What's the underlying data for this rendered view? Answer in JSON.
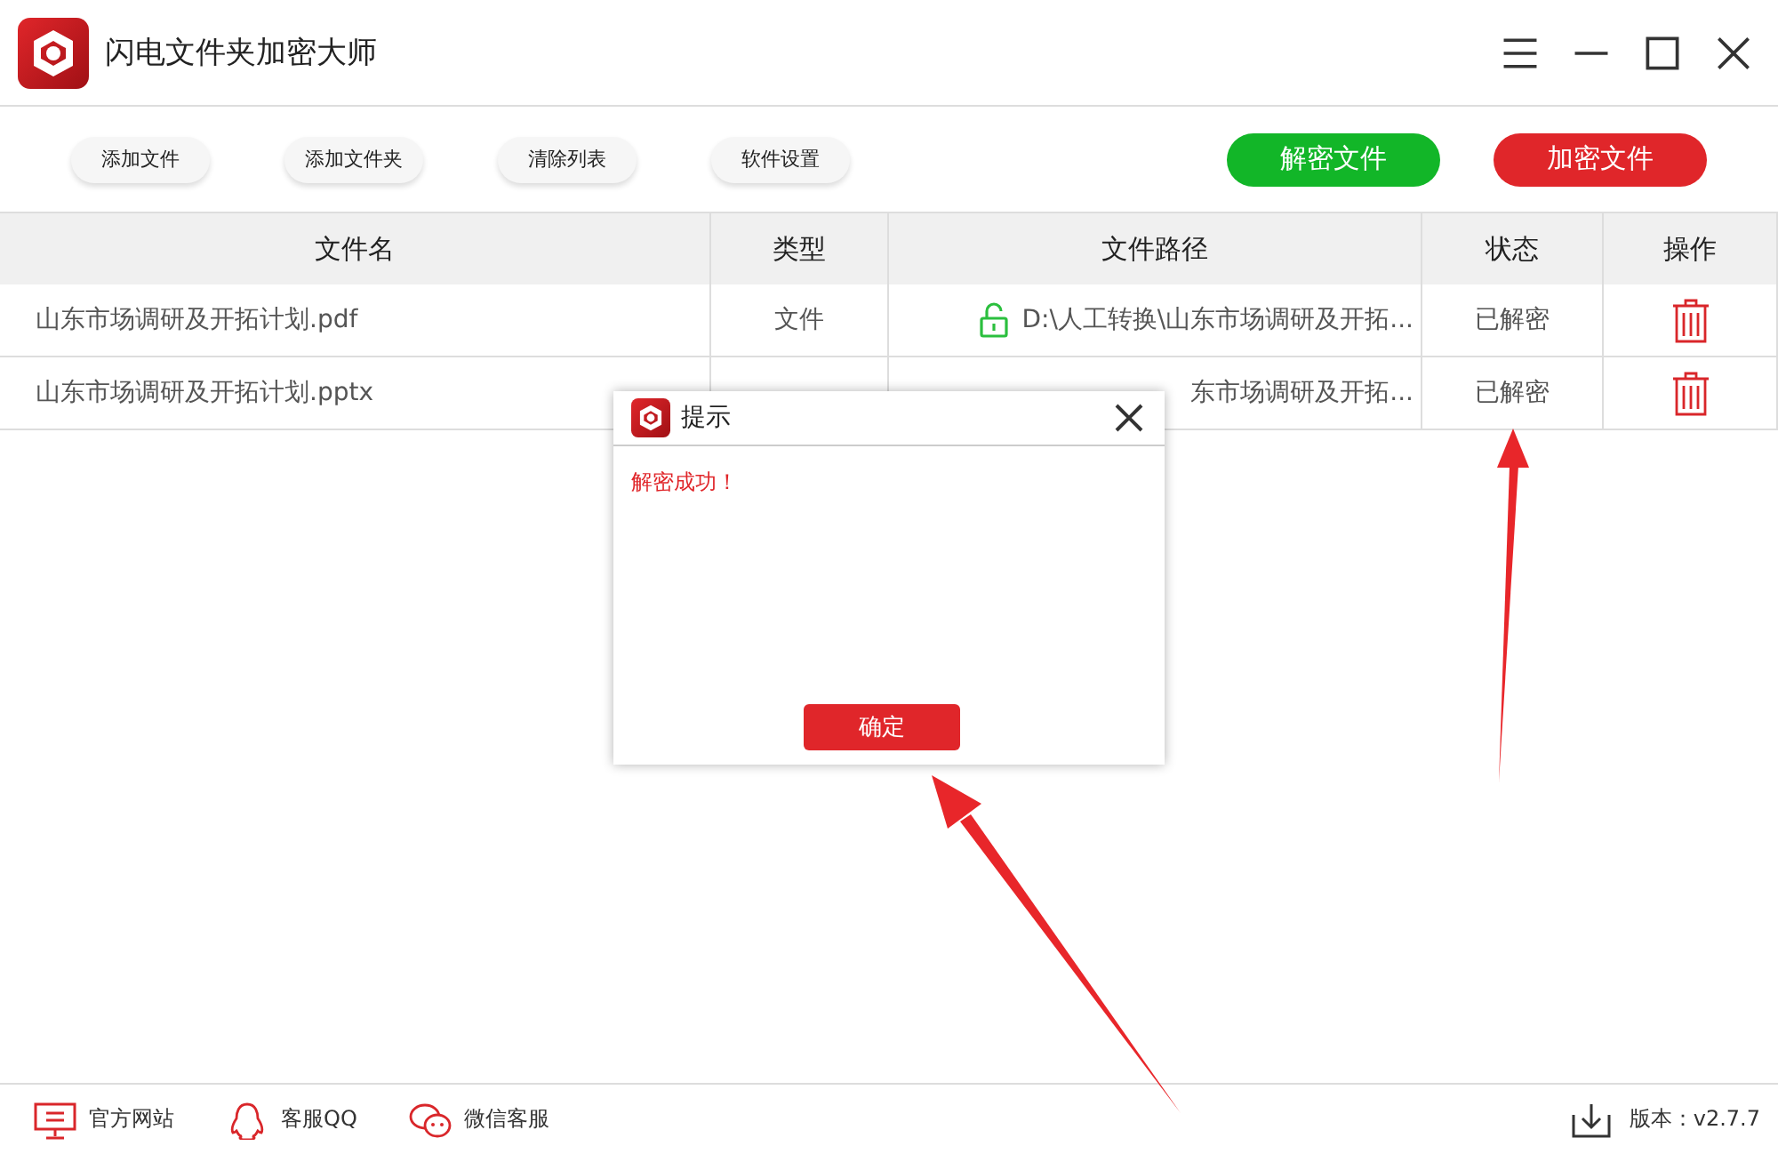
{
  "window": {
    "title": "闪电文件夹加密大师"
  },
  "toolbar": {
    "left_buttons": [
      "添加文件",
      "添加文件夹",
      "清除列表",
      "软件设置"
    ],
    "right_buttons": [
      {
        "label": "解密文件",
        "kind": "decrypt"
      },
      {
        "label": "加密文件",
        "kind": "encrypt"
      }
    ]
  },
  "table": {
    "columns": [
      "文件名",
      "类型",
      "文件路径",
      "状态",
      "操作"
    ],
    "rows": [
      {
        "name": "山东市场调研及开拓计划.pdf",
        "type": "文件",
        "path": "D:\\人工转换\\山东市场调研及开拓...",
        "lock_icon": true,
        "status": "已解密"
      },
      {
        "name": "山东市场调研及开拓计划.pptx",
        "path": "东市场调研及开拓...",
        "lock_icon": false,
        "status": "已解密"
      }
    ]
  },
  "dialog": {
    "title": "提示",
    "message": "解密成功！",
    "button": "确定"
  },
  "status_bar": {
    "links": [
      {
        "label": "官方网站",
        "kind": "monitor"
      },
      {
        "label": "客服QQ",
        "kind": "qq"
      },
      {
        "label": "微信客服",
        "kind": "wechat"
      }
    ],
    "version": "版本：v2.7.7"
  }
}
